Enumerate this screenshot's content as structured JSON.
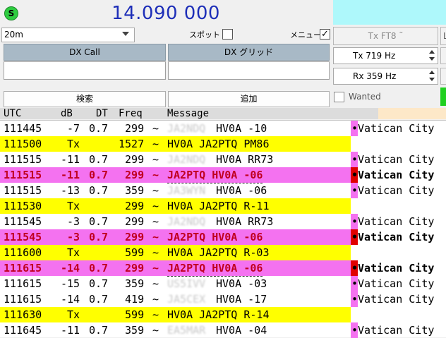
{
  "header": {
    "status_badge": "S",
    "frequency": "14.090 000"
  },
  "controls": {
    "band": "20m",
    "spot_label": "スポット",
    "menu_label": "メニュー",
    "menu_checked": "✓",
    "tx_mode_button": "Tx FT8 ˜",
    "right_edge_btn": "L",
    "dx_call_label": "DX Call",
    "dx_grid_label": "DX グリッド",
    "tx_freq": "Tx  719  Hz",
    "rx_freq": "Rx  359  Hz",
    "search_button": "検索",
    "add_button": "追加",
    "wanted_label": "Wanted"
  },
  "log": {
    "columns": [
      "UTC",
      "dB",
      "DT",
      "Freq",
      "Message"
    ],
    "rows": [
      {
        "utc": "111445",
        "db": "-7",
        "dt": "0.7",
        "freq": "299",
        "tilde": "~",
        "call1": "JA2NDQ",
        "rest": "HV0A -10",
        "country": "Vatican City",
        "style": "normal"
      },
      {
        "utc": "111500",
        "db": "Tx",
        "dt": "",
        "freq": "1527",
        "tilde": "~",
        "call1": "",
        "rest": "HV0A JA2PTQ PM86",
        "country": "",
        "style": "tx"
      },
      {
        "utc": "111515",
        "db": "-11",
        "dt": "0.7",
        "freq": "299",
        "tilde": "~",
        "call1": "JA2NDQ",
        "rest": "HV0A RR73",
        "country": "Vatican City",
        "style": "normal"
      },
      {
        "utc": "111515",
        "db": "-11",
        "dt": "0.7",
        "freq": "299",
        "tilde": "~",
        "call1": "",
        "rest": "JA2PTQ HV0A -06",
        "country": "Vatican City",
        "style": "me"
      },
      {
        "utc": "111515",
        "db": "-13",
        "dt": "0.7",
        "freq": "359",
        "tilde": "~",
        "call1": "JA3WYN",
        "rest": "HV0A -06",
        "country": "Vatican City",
        "style": "normal"
      },
      {
        "utc": "111530",
        "db": "Tx",
        "dt": "",
        "freq": "299",
        "tilde": "~",
        "call1": "",
        "rest": "HV0A JA2PTQ R-11",
        "country": "",
        "style": "tx"
      },
      {
        "utc": "111545",
        "db": "-3",
        "dt": "0.7",
        "freq": "299",
        "tilde": "~",
        "call1": "JA2NDQ",
        "rest": "HV0A RR73",
        "country": "Vatican City",
        "style": "normal"
      },
      {
        "utc": "111545",
        "db": "-3",
        "dt": "0.7",
        "freq": "299",
        "tilde": "~",
        "call1": "",
        "rest": "JA2PTQ HV0A -06",
        "country": "Vatican City",
        "style": "me"
      },
      {
        "utc": "111600",
        "db": "Tx",
        "dt": "",
        "freq": "599",
        "tilde": "~",
        "call1": "",
        "rest": "HV0A JA2PTQ R-03",
        "country": "",
        "style": "tx"
      },
      {
        "utc": "111615",
        "db": "-14",
        "dt": "0.7",
        "freq": "299",
        "tilde": "~",
        "call1": "",
        "rest": "JA2PTQ HV0A -06",
        "country": "Vatican City",
        "style": "me"
      },
      {
        "utc": "111615",
        "db": "-15",
        "dt": "0.7",
        "freq": "359",
        "tilde": "~",
        "call1": "US5IVV",
        "rest": "HV0A -03",
        "country": "Vatican City",
        "style": "normal"
      },
      {
        "utc": "111615",
        "db": "-14",
        "dt": "0.7",
        "freq": "419",
        "tilde": "~",
        "call1": "JA5CEX",
        "rest": "HV0A -17",
        "country": "Vatican City",
        "style": "normal"
      },
      {
        "utc": "111630",
        "db": "Tx",
        "dt": "",
        "freq": "599",
        "tilde": "~",
        "call1": "",
        "rest": "HV0A JA2PTQ R-14",
        "country": "",
        "style": "tx"
      },
      {
        "utc": "111645",
        "db": "-11",
        "dt": "0.7",
        "freq": "359",
        "tilde": "~",
        "call1": "EA5MAR",
        "rest": "HV0A -04",
        "country": "Vatican City",
        "style": "normal"
      }
    ]
  },
  "colors": {
    "tx_highlight": "#ffff00",
    "me_highlight": "#f472f0",
    "marker_pink": "#f472f0",
    "marker_red": "#e00000"
  }
}
